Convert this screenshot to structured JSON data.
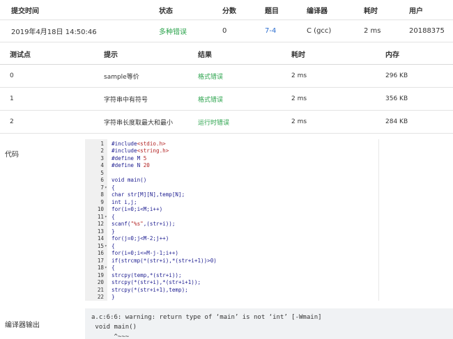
{
  "submission": {
    "headers": {
      "time": "提交时间",
      "status": "状态",
      "score": "分数",
      "problem": "题目",
      "compiler": "编译器",
      "cost": "耗时",
      "user": "用户"
    },
    "row": {
      "time": "2019年4月18日 14:50:46",
      "status": "多种错误",
      "score": "0",
      "problem": "7-4",
      "compiler": "C (gcc)",
      "cost": "2 ms",
      "user": "20188375"
    }
  },
  "cases": {
    "headers": {
      "no": "测试点",
      "hint": "提示",
      "result": "结果",
      "cost": "耗时",
      "mem": "内存"
    },
    "rows": [
      {
        "no": "0",
        "hint": "sample等价",
        "result": "格式错误",
        "cost": "2 ms",
        "mem": "296 KB"
      },
      {
        "no": "1",
        "hint": "字符串中有符号",
        "result": "格式错误",
        "cost": "2 ms",
        "mem": "356 KB"
      },
      {
        "no": "2",
        "hint": "字符串长度取最大和最小",
        "result": "运行时错误",
        "cost": "2 ms",
        "mem": "284 KB"
      }
    ]
  },
  "code_label": "代码",
  "code_lines": [
    "#include<stdio.h>",
    "#include<string.h>",
    "#define M 5",
    "#define N 20",
    "",
    "void main()",
    "{",
    "char str[M][N],temp[N];",
    "int i,j;",
    "for(i=0;i<M;i++)",
    "{",
    "scanf(\"%s\",(str+i));",
    "}",
    "for(j=0;j<M-2;j++)",
    "{",
    "for(i=0;i<=M-j-1;i++)",
    "if(strcmp(*(str+i),*(str+i+1))>0)",
    "{",
    "strcpy(temp,*(str+i));",
    "strcpy(*(str+i),*(str+i+1));",
    "strcpy(*(str+i+1),temp);",
    "}",
    "}"
  ],
  "fold_lines": [
    7,
    11,
    15,
    18
  ],
  "fold_glyph": "▾",
  "output_label": "编译器输出",
  "output_lines": [
    "a.c:6:6: warning: return type of ‘main’ is not ‘int’ [-Wmain]",
    " void main()",
    "      ^~~~"
  ],
  "colors": {
    "ok_green": "#2da44e",
    "link_blue": "#2e6fd0",
    "string_red": "#b22222",
    "code_blue": "#1b1b8f"
  }
}
